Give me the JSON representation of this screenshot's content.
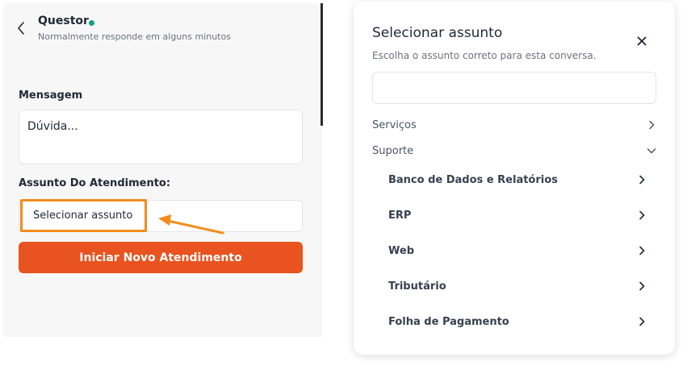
{
  "chat": {
    "agent_name": "Questor",
    "status_text": "Normalmente responde em alguns minutos",
    "status_color": "#10a37f",
    "message_label": "Mensagem",
    "message_value": "Dúvida...",
    "subject_label": "Assunto Do Atendimento:",
    "subject_value": "Selecionar assunto",
    "start_button": "Iniciar Novo Atendimento",
    "accent_color": "#e8531f",
    "highlight_color": "#f28c1b"
  },
  "modal": {
    "title": "Selecionar assunto",
    "subtitle": "Escolha o assunto correto para esta conversa.",
    "search_value": "",
    "categories": [
      {
        "label": "Serviços",
        "icon": "chevron-right-icon",
        "expanded": false
      },
      {
        "label": "Suporte",
        "icon": "chevron-down-icon",
        "expanded": true
      }
    ],
    "suporte_items": [
      {
        "label": "Banco de Dados e Relatórios",
        "icon": "chevron-right-icon"
      },
      {
        "label": "ERP",
        "icon": "chevron-right-icon"
      },
      {
        "label": "Web",
        "icon": "chevron-right-icon"
      },
      {
        "label": "Tributário",
        "icon": "chevron-right-icon"
      },
      {
        "label": "Folha de Pagamento",
        "icon": "chevron-right-icon"
      }
    ]
  }
}
